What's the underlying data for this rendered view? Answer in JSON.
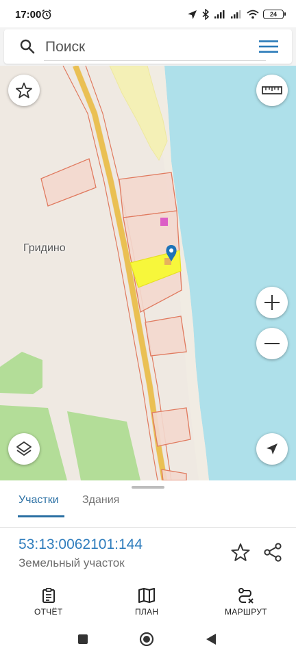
{
  "status_bar": {
    "time": "17:00",
    "battery": "24",
    "icons": [
      "alarm-icon",
      "location-arrow-icon",
      "bluetooth-icon",
      "signal-icon",
      "signal-icon",
      "wifi-icon",
      "battery-icon"
    ]
  },
  "search": {
    "placeholder": "Поиск",
    "icons": [
      "search-icon",
      "menu-icon"
    ]
  },
  "map": {
    "place_label": "Гридино",
    "controls": [
      "star-icon",
      "ruler-icon",
      "layers-icon",
      "zoom-in-icon",
      "zoom-out-icon",
      "navigation-arrow-icon",
      "location-pin-icon"
    ],
    "colors": {
      "land": "#efe9e2",
      "water": "#aee0ea",
      "grass": "#b3dd98",
      "road": "#f1c95b",
      "parcel_border": "#e07a5f",
      "selected_parcel": "#f7f73b",
      "pin": "#1e73b8"
    }
  },
  "sheet": {
    "tabs": [
      {
        "label": "Участки",
        "active": true
      },
      {
        "label": "Здания",
        "active": false
      }
    ],
    "parcel": {
      "number": "53:13:0062101:144",
      "type": "Земельный участок"
    },
    "icons": [
      "star-outline-icon",
      "share-icon"
    ],
    "accent_color": "#2a6fa3"
  },
  "actions": {
    "report": "ОТЧЁТ",
    "plan": "ПЛАН",
    "route": "МАРШРУТ"
  },
  "android_nav": [
    "recents-button",
    "home-button",
    "back-button"
  ]
}
